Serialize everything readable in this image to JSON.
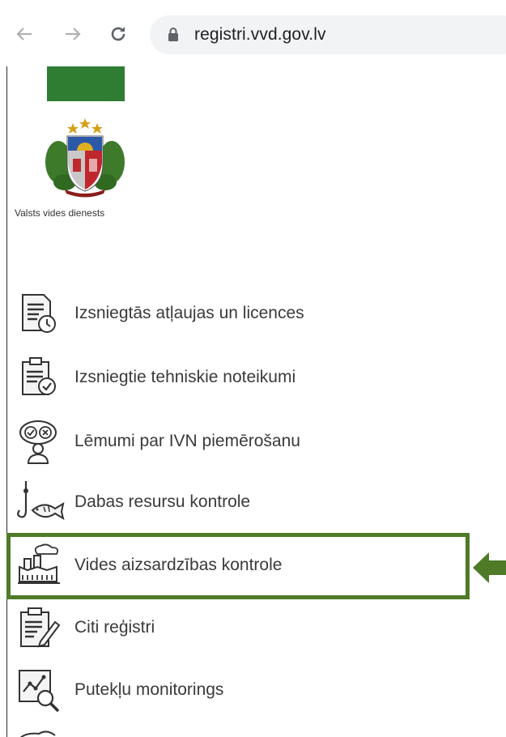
{
  "browser": {
    "url": "registri.vvd.gov.lv",
    "icons": [
      "back-arrow-icon",
      "forward-arrow-icon",
      "reload-icon",
      "lock-icon"
    ]
  },
  "logo": {
    "org_name": "Valsts vides dienests",
    "icon": "coat-of-arms-icon",
    "bar_color": "#2e7d32"
  },
  "menu": {
    "items": [
      {
        "label": "Izsniegtās atļaujas un licences",
        "icon": "permit-document-icon"
      },
      {
        "label": "Izsniegtie tehniskie noteikumi",
        "icon": "clipboard-check-icon"
      },
      {
        "label": "Lēmumi par IVN piemērošanu",
        "icon": "decision-person-icon"
      },
      {
        "label": "Dabas resursu kontrole",
        "icon": "fishing-hook-fish-icon"
      },
      {
        "label": "Vides aizsardzības kontrole",
        "icon": "factory-smoke-icon"
      },
      {
        "label": "Citi reģistri",
        "icon": "document-pen-icon"
      },
      {
        "label": "Putekļu monitorings",
        "icon": "chart-magnifier-icon"
      }
    ],
    "highlighted_index": 4,
    "highlight_color": "#4f7a28"
  }
}
